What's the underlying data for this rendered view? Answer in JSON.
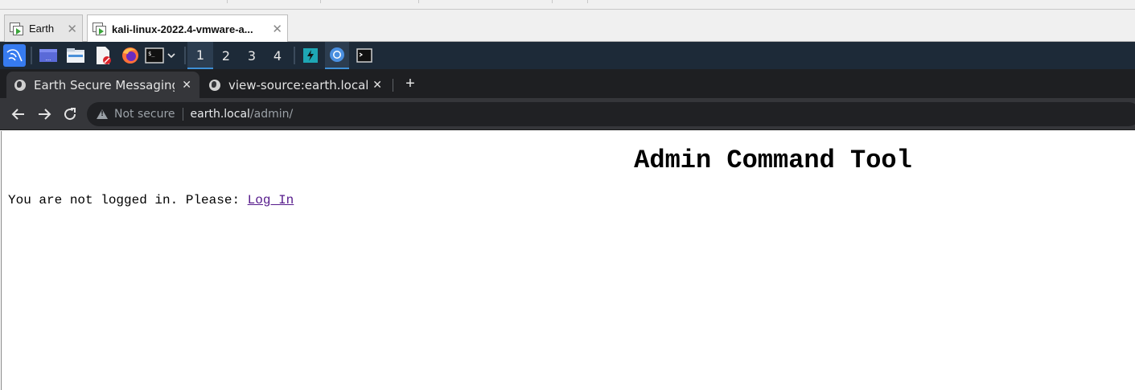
{
  "host": {
    "tabs": [
      {
        "label": "Earth",
        "active": false
      },
      {
        "label": "kali-linux-2022.4-vmware-a...",
        "active": true
      }
    ]
  },
  "panel": {
    "workspaces": [
      "1",
      "2",
      "3",
      "4"
    ],
    "active_workspace": "1",
    "colors": {
      "background": "#1d2a38",
      "accent": "#3d8fd6"
    }
  },
  "browser": {
    "tabs": [
      {
        "title": "Earth Secure Messaging A",
        "active": true
      },
      {
        "title": "view-source:earth.local",
        "active": false
      }
    ],
    "new_tab_label": "+",
    "address": {
      "security_label": "Not secure",
      "host": "earth.local",
      "path": "/admin/"
    }
  },
  "page": {
    "heading": "Admin Command Tool",
    "message": "You are not logged in. Please: ",
    "login_link": "Log In"
  }
}
